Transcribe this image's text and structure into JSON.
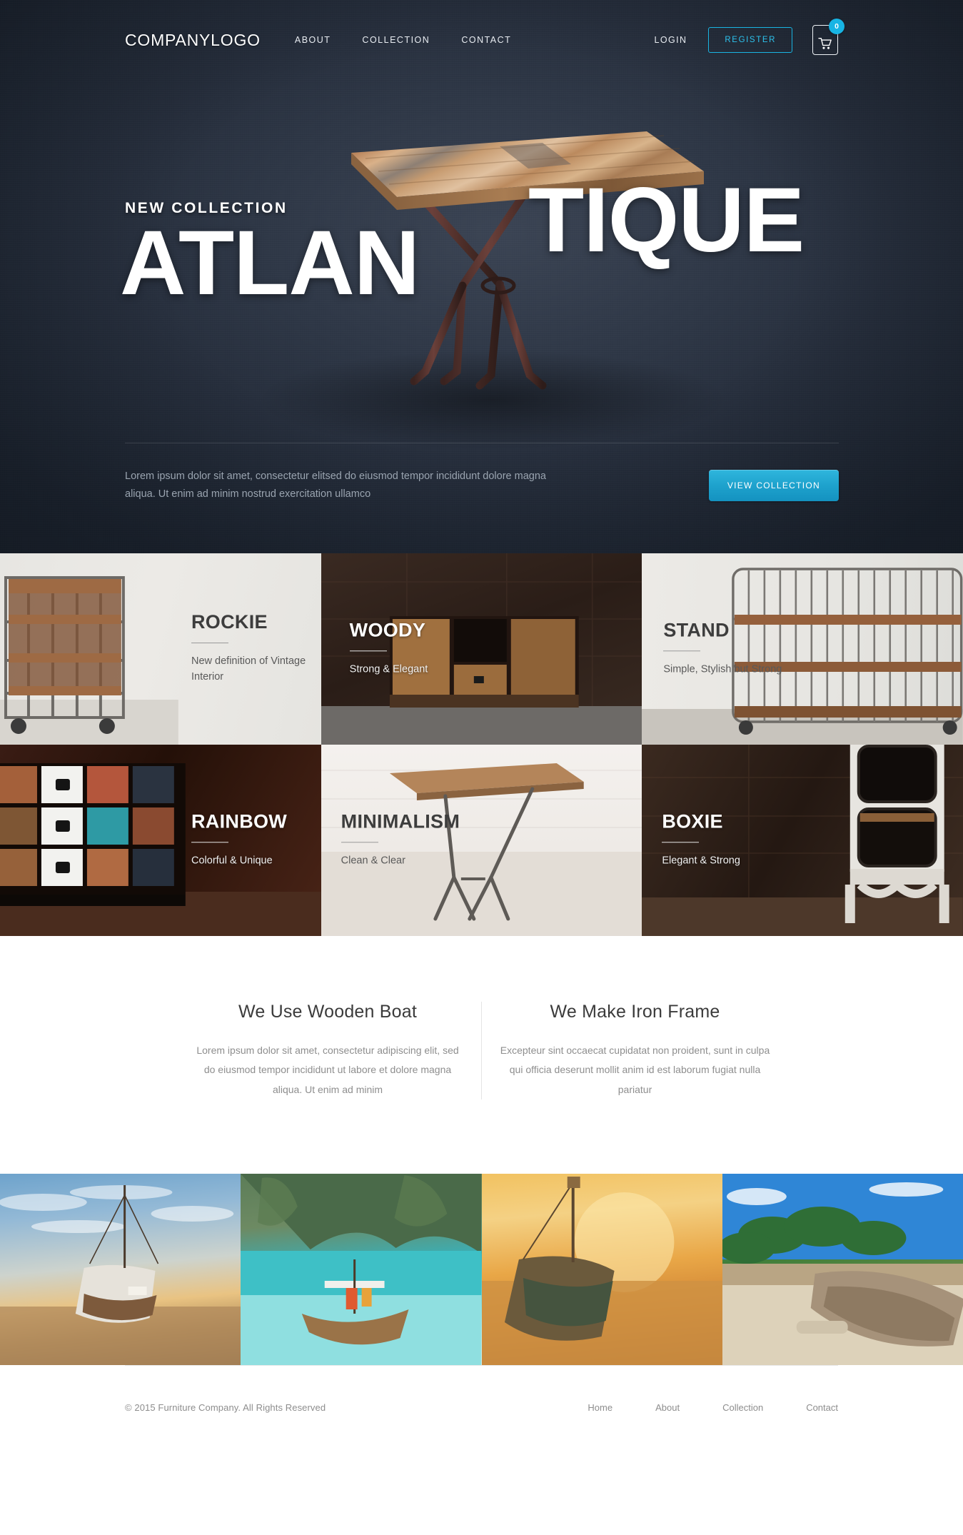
{
  "header": {
    "logo": "COMPANYLOGO",
    "nav": [
      {
        "label": "ABOUT"
      },
      {
        "label": "COLLECTION"
      },
      {
        "label": "CONTACT"
      }
    ],
    "login_label": "LOGIN",
    "register_label": "REGISTER",
    "cart_count": "0",
    "cart_icon": "shopping-cart-icon"
  },
  "hero": {
    "eyebrow": "NEW COLLECTION",
    "title_part_a": "ATLAN",
    "title_part_b": "TIQUE",
    "paragraph": "Lorem ipsum dolor sit amet, consectetur elitsed do eiusmod tempor incididunt dolore magna aliqua. Ut enim ad minim nostrud exercitation ullamco",
    "cta_label": "VIEW COLLECTION",
    "accent_color": "#1ea2cd",
    "background_color": "#2b3342"
  },
  "products": [
    {
      "name": "ROCKIE",
      "tagline": "New definition of Vintage Interior",
      "theme": "dark",
      "bg": "bg-rockie",
      "align": "right"
    },
    {
      "name": "WOODY",
      "tagline": "Strong & Elegant",
      "theme": "light",
      "bg": "bg-woody",
      "align": "left"
    },
    {
      "name": "STAND",
      "tagline": "Simple, Stylish but Strong",
      "theme": "dark",
      "bg": "bg-stand",
      "align": "left"
    },
    {
      "name": "RAINBOW",
      "tagline": "Colorful & Unique",
      "theme": "light",
      "bg": "bg-rainbow",
      "align": "right"
    },
    {
      "name": "MINIMALISM",
      "tagline": "Clean & Clear",
      "theme": "dark",
      "bg": "bg-minimal",
      "align": "left"
    },
    {
      "name": "BOXIE",
      "tagline": "Elegant & Strong",
      "theme": "light",
      "bg": "bg-boxie",
      "align": "left"
    }
  ],
  "features": [
    {
      "title": "We Use Wooden Boat",
      "text": "Lorem ipsum dolor sit amet, consectetur adipiscing elit, sed do eiusmod tempor incididunt ut labore et dolore magna aliqua. Ut enim ad minim"
    },
    {
      "title": "We Make Iron Frame",
      "text": "Excepteur sint occaecat cupidatat non proident, sunt in culpa qui officia deserunt mollit anim id est laborum  fugiat nulla pariatur"
    }
  ],
  "gallery": [
    {
      "alt": "wooden-boat-on-beach-at-sunset"
    },
    {
      "alt": "longtail-boat-in-turquoise-lagoon"
    },
    {
      "alt": "old-boat-on-golden-sand-beach"
    },
    {
      "alt": "canoe-under-palm-trees"
    }
  ],
  "footer": {
    "copyright": "© 2015 Furniture Company. All Rights Reserved",
    "links": [
      {
        "label": "Home"
      },
      {
        "label": "About"
      },
      {
        "label": "Collection"
      },
      {
        "label": "Contact"
      }
    ]
  }
}
